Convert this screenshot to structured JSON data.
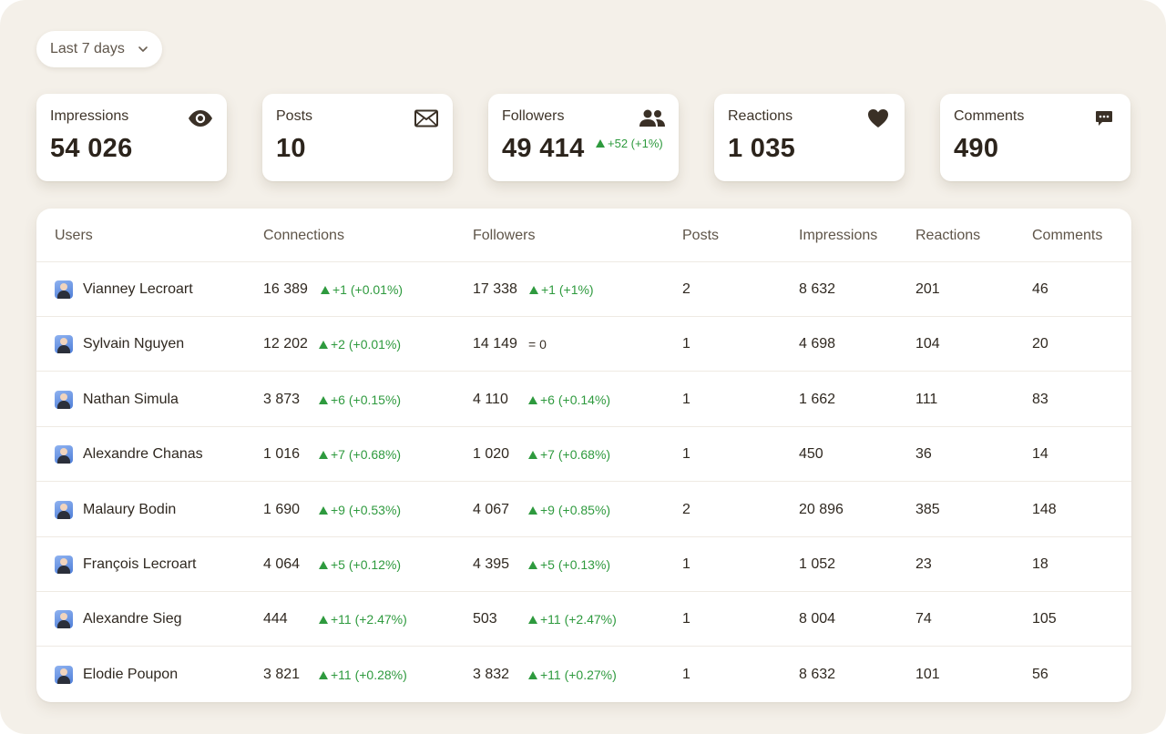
{
  "filter": {
    "period_label": "Last 7 days"
  },
  "kpis": [
    {
      "label": "Impressions",
      "value": "54 026",
      "icon": "eye-icon"
    },
    {
      "label": "Posts",
      "value": "10",
      "icon": "envelope-icon"
    },
    {
      "label": "Followers",
      "value": "49 414",
      "icon": "people-icon",
      "delta": "+52 (+1%)"
    },
    {
      "label": "Reactions",
      "value": "1 035",
      "icon": "heart-icon"
    },
    {
      "label": "Comments",
      "value": "490",
      "icon": "comment-icon"
    }
  ],
  "table": {
    "headers": [
      "Users",
      "Connections",
      "Followers",
      "Posts",
      "Impressions",
      "Reactions",
      "Comments"
    ],
    "rows": [
      {
        "user": "Vianney Lecroart",
        "connections": "16 389",
        "connections_delta": "+1 (+0.01%)",
        "followers": "17 338",
        "followers_delta": "+1 (+1%)",
        "posts": "2",
        "impressions": "8 632",
        "reactions": "201",
        "comments": "46"
      },
      {
        "user": "Sylvain Nguyen",
        "connections": "12 202",
        "connections_delta": "+2 (+0.01%)",
        "followers": "14 149",
        "followers_delta": "0",
        "followers_delta_neutral": true,
        "posts": "1",
        "impressions": "4 698",
        "reactions": "104",
        "comments": "20"
      },
      {
        "user": "Nathan Simula",
        "connections": "3 873",
        "connections_delta": "+6 (+0.15%)",
        "followers": "4 110",
        "followers_delta": "+6 (+0.14%)",
        "posts": "1",
        "impressions": "1 662",
        "reactions": "111",
        "comments": "83"
      },
      {
        "user": "Alexandre Chanas",
        "connections": "1 016",
        "connections_delta": "+7 (+0.68%)",
        "followers": "1 020",
        "followers_delta": "+7 (+0.68%)",
        "posts": "1",
        "impressions": "450",
        "reactions": "36",
        "comments": "14"
      },
      {
        "user": "Malaury Bodin",
        "connections": "1 690",
        "connections_delta": "+9 (+0.53%)",
        "followers": "4 067",
        "followers_delta": "+9 (+0.85%)",
        "posts": "2",
        "impressions": "20 896",
        "reactions": "385",
        "comments": "148"
      },
      {
        "user": "François Lecroart",
        "connections": "4 064",
        "connections_delta": "+5 (+0.12%)",
        "followers": "4 395",
        "followers_delta": "+5 (+0.13%)",
        "posts": "1",
        "impressions": "1 052",
        "reactions": "23",
        "comments": "18"
      },
      {
        "user": "Alexandre Sieg",
        "connections": "444",
        "connections_delta": "+11 (+2.47%)",
        "followers": "503",
        "followers_delta": "+11 (+2.47%)",
        "posts": "1",
        "impressions": "8 004",
        "reactions": "74",
        "comments": "105"
      },
      {
        "user": "Elodie Poupon",
        "connections": "3 821",
        "connections_delta": "+11 (+0.28%)",
        "followers": "3 832",
        "followers_delta": "+11 (+0.27%)",
        "posts": "1",
        "impressions": "8 632",
        "reactions": "101",
        "comments": "56"
      }
    ]
  },
  "colors": {
    "background": "#f4f0e9",
    "positive": "#2e9a3e",
    "text": "#2f2820",
    "icon": "#3a3026"
  }
}
